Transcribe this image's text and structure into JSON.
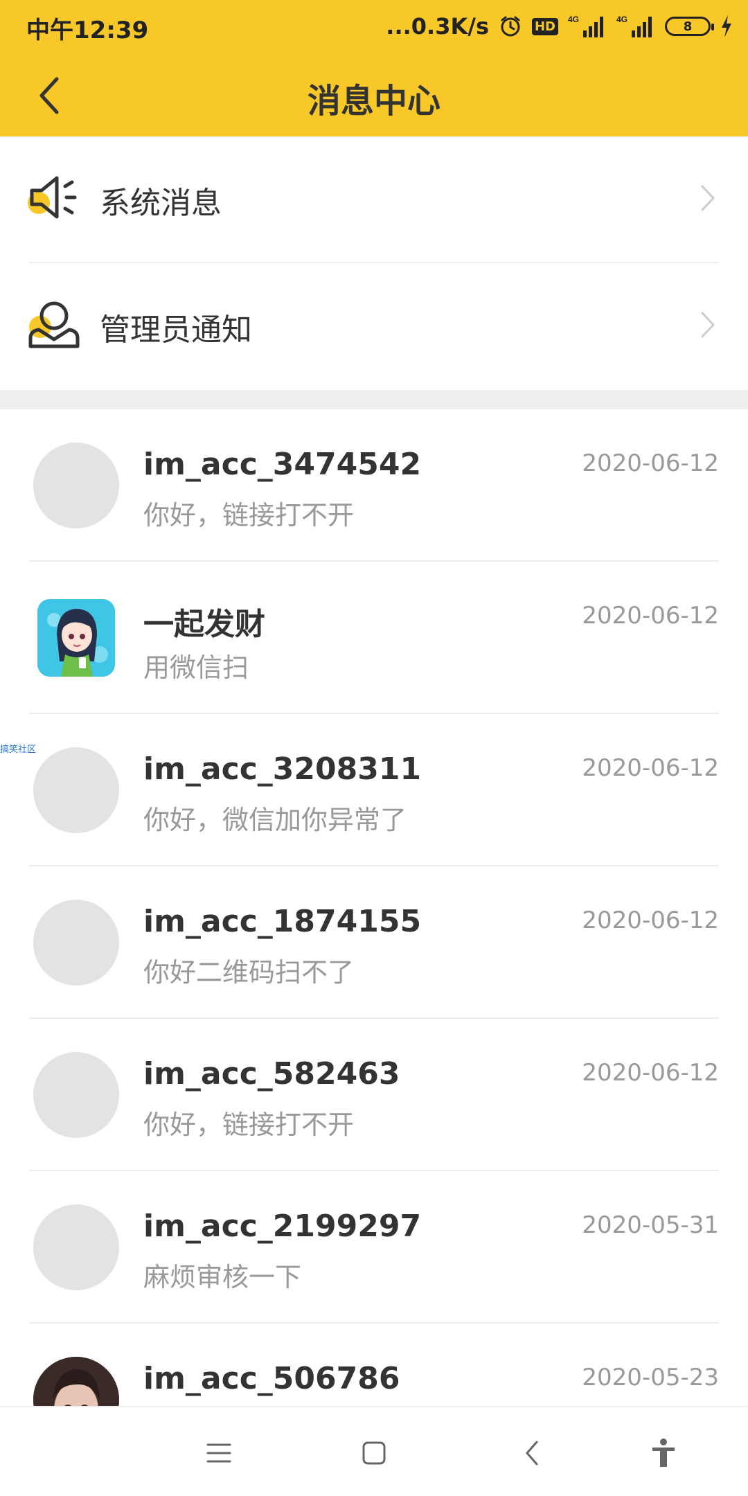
{
  "status_bar": {
    "time": "中午12:39",
    "network_speed": "...0.3K/s",
    "hd_label": "HD",
    "signal1_label": "4G",
    "signal2_label": "4G",
    "battery_level": "8"
  },
  "header": {
    "title": "消息中心",
    "back_icon": "chevron-left-icon",
    "background_color": "#F8C829"
  },
  "system_section": [
    {
      "label": "系统消息",
      "icon": "speaker-icon"
    },
    {
      "label": "管理员通知",
      "icon": "admin-user-icon"
    }
  ],
  "watermark": "搞笑社区",
  "conversations": [
    {
      "name": "im_acc_3474542",
      "message": "你好，链接打不开",
      "date": "2020-06-12",
      "avatar": "placeholder"
    },
    {
      "name": "一起发财",
      "message": "用微信扫",
      "date": "2020-06-12",
      "avatar": "anime-girl"
    },
    {
      "name": "im_acc_3208311",
      "message": "你好，微信加你异常了",
      "date": "2020-06-12",
      "avatar": "placeholder"
    },
    {
      "name": "im_acc_1874155",
      "message": "你好二维码扫不了",
      "date": "2020-06-12",
      "avatar": "placeholder"
    },
    {
      "name": "im_acc_582463",
      "message": "你好，链接打不开",
      "date": "2020-06-12",
      "avatar": "placeholder"
    },
    {
      "name": "im_acc_2199297",
      "message": "麻烦审核一下",
      "date": "2020-05-31",
      "avatar": "placeholder"
    },
    {
      "name": "im_acc_506786",
      "message": "",
      "date": "2020-05-23",
      "avatar": "photo"
    }
  ],
  "nav_bar": {
    "icons": [
      "menu-icon",
      "home-icon",
      "back-icon",
      "accessibility-icon"
    ]
  }
}
